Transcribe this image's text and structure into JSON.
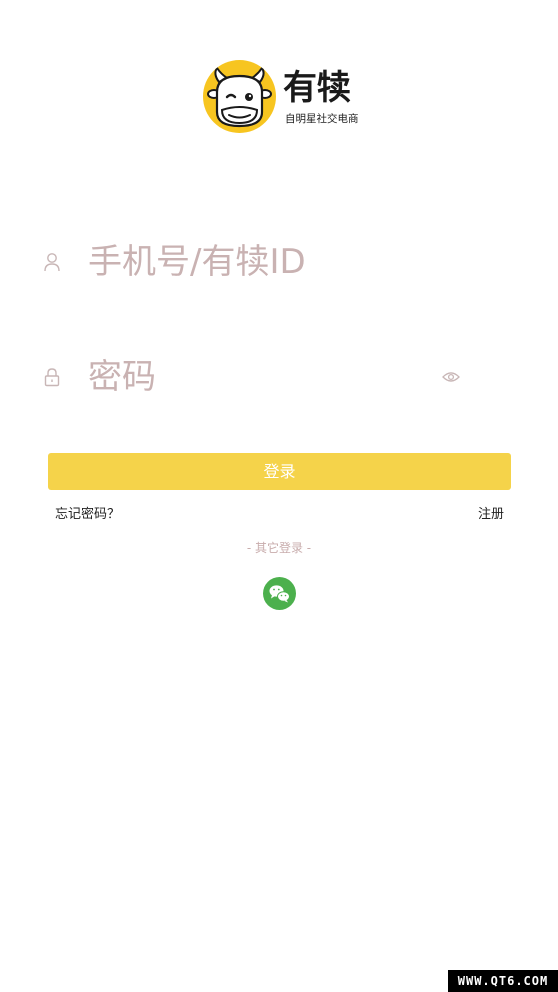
{
  "brand": {
    "name": "有犊",
    "slogan": "自明星社交电商",
    "accent_color": "#f7c520"
  },
  "login_form": {
    "username": {
      "placeholder": "手机号/有犊ID",
      "value": "",
      "icon": "user-icon"
    },
    "password": {
      "placeholder": "密码",
      "value": "",
      "icon": "lock-icon",
      "toggle_icon": "eye-icon"
    },
    "submit_label": "登录",
    "button_color": "#f5d34a"
  },
  "links": {
    "forgot_password": "忘记密码？",
    "register": "注册"
  },
  "other_login": {
    "label": "- 其它登录 -",
    "providers": [
      {
        "name": "wechat",
        "icon": "wechat-icon",
        "color": "#4cb04d"
      }
    ]
  },
  "watermark": "WWW.QT6.COM"
}
